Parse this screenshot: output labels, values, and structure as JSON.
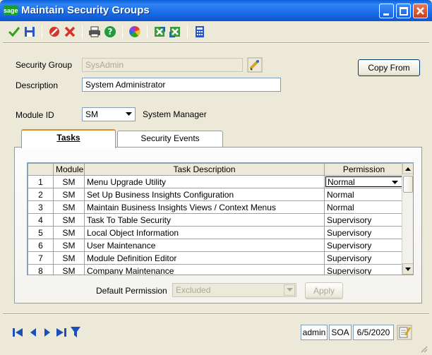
{
  "window": {
    "title": "Maintain Security Groups",
    "logo_text": "sage"
  },
  "toolbar": {
    "icons": [
      "accept-icon",
      "save-icon",
      "cancel-icon",
      "delete-icon",
      "print-icon",
      "help-icon",
      "color-wheel-icon",
      "export-icon",
      "import-icon",
      "calculator-icon"
    ]
  },
  "form": {
    "security_group_label": "Security Group",
    "security_group_value": "SysAdmin",
    "description_label": "Description",
    "description_value": "System Administrator",
    "copy_from_label": "Copy From",
    "module_id_label": "Module ID",
    "module_id_value": "SM",
    "module_name": "System Manager"
  },
  "tabs": [
    {
      "label": "Tasks",
      "active": true
    },
    {
      "label": "Security Events",
      "active": false
    }
  ],
  "grid": {
    "columns": [
      "",
      "Module",
      "Task Description",
      "Permission"
    ],
    "rows": [
      {
        "num": "1",
        "module": "SM",
        "task": "Menu Upgrade Utility",
        "permission": "Normal"
      },
      {
        "num": "2",
        "module": "SM",
        "task": "Set Up Business Insights Configuration",
        "permission": "Normal"
      },
      {
        "num": "3",
        "module": "SM",
        "task": "Maintain Business Insights Views / Context Menus",
        "permission": "Normal"
      },
      {
        "num": "4",
        "module": "SM",
        "task": "Task To Table Security",
        "permission": "Supervisory"
      },
      {
        "num": "5",
        "module": "SM",
        "task": "Local Object Information",
        "permission": "Supervisory"
      },
      {
        "num": "6",
        "module": "SM",
        "task": "User Maintenance",
        "permission": "Supervisory"
      },
      {
        "num": "7",
        "module": "SM",
        "task": "Module Definition Editor",
        "permission": "Supervisory"
      },
      {
        "num": "8",
        "module": "SM",
        "task": "Company Maintenance",
        "permission": "Supervisory"
      }
    ]
  },
  "default_permission": {
    "label": "Default Permission",
    "value": "Excluded",
    "apply_label": "Apply"
  },
  "statusbar": {
    "user": "admin",
    "company": "SOA",
    "date": "6/5/2020"
  },
  "colors": {
    "titlebar": "#0a5fd8",
    "window_bg": "#ece9d8",
    "tab_accent": "#e68b2c"
  }
}
